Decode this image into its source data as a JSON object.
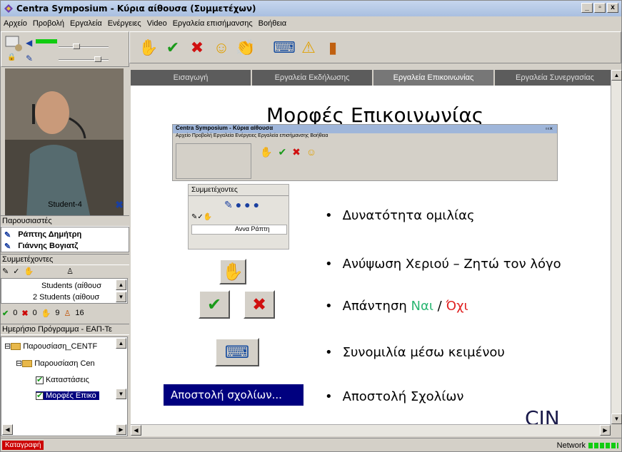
{
  "window": {
    "title": "Centra Symposium - Κύρια αίθουσα (Συμμετέχων)",
    "controls": [
      "_",
      "▫",
      "x"
    ]
  },
  "menu": [
    "Αρχείο",
    "Προβολή",
    "Εργαλεία",
    "Ενέργειες",
    "Video",
    "Εργαλεία επισήμανσης",
    "Βοήθεια"
  ],
  "left": {
    "student_label": "Student-4",
    "presenters_header": "Παρουσιαστές",
    "presenters": [
      "Ράπτης Δημήτρη",
      "Γιάννης Βογιατζ"
    ],
    "participants_header": "Συμμετέχοντες",
    "participants": [
      "Students (αίθουσ",
      "2 Students (αίθουσ"
    ],
    "counts": {
      "yes": "0",
      "no": "0",
      "hand": "9",
      "people": "16"
    },
    "agenda_header": "Ημερήσιο Πρόγραμμα - ΕΑΠ-Τε",
    "agenda": [
      "Παρουσίαση_CENTF",
      "Παρουσίαση Cen",
      "Καταστάσεις",
      "Μορφές Επικο"
    ]
  },
  "tabs": [
    "Εισαγωγή",
    "Εργαλεία Εκδήλωσης",
    "Εργαλεία Επικοινωνίας",
    "Εργαλεία Συνεργασίας"
  ],
  "slide": {
    "title": "Μορφές Επικοινωνίας",
    "mini_title": "Centra Symposium - Κύρια αίθουσα",
    "mini_menu": "Αρχείο  Προβολή  Εργαλεία  Ενέργειες  Εργαλεία επισήμανσης  Βοήθεια",
    "panel_header": "Συμμετέχοντες",
    "panel_name": "Αννα Ράπτη",
    "bullets": [
      "Δυνατότητα ομιλίας",
      "Ανύψωση Χεριού – Ζητώ τον λόγο",
      "Απάντηση",
      "Συνομιλία μέσω κειμένου",
      "Αποστολή Σχολίων"
    ],
    "yes": "Ναι",
    "sep": " / ",
    "no": "Όχι",
    "send_btn": "Αποστολή σχολίων...",
    "logo": "CIN"
  },
  "status": {
    "record": "Καταγραφή",
    "network": "Network"
  },
  "colors": {
    "yes": "#2bb673",
    "no": "#e02020",
    "send_bg": "#00007f"
  }
}
